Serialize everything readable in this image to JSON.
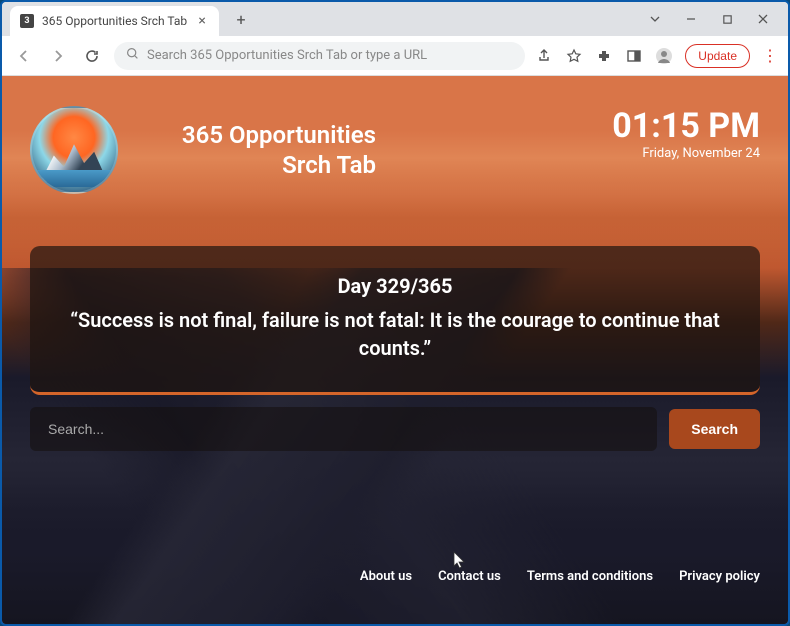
{
  "browser": {
    "tab_title": "365 Opportunities Srch Tab",
    "omnibox_placeholder": "Search 365 Opportunities Srch Tab or type a URL",
    "update_label": "Update"
  },
  "header": {
    "brand_title": "365 Opportunities Srch Tab",
    "time": "01:15 PM",
    "date": "Friday, November 24"
  },
  "quote": {
    "day": "Day 329/365",
    "text": "“Success is not final, failure is not fatal: It is the courage to continue that counts.”"
  },
  "search": {
    "placeholder": "Search...",
    "button_label": "Search"
  },
  "footer": {
    "links": [
      "About us",
      "Contact us",
      "Terms and conditions",
      "Privacy policy"
    ]
  }
}
